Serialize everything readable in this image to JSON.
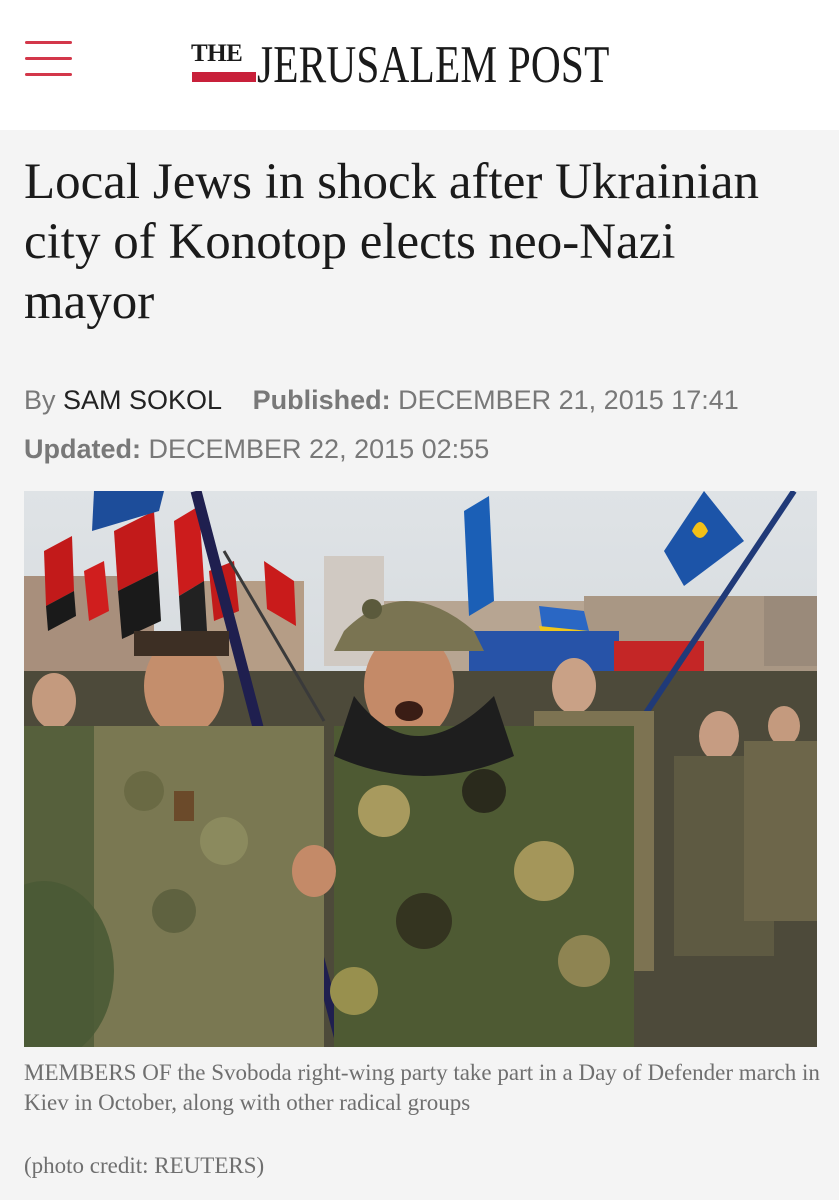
{
  "header": {
    "logo_the": "THE",
    "logo_name": "JERUSALEM POST",
    "accent_color": "#d3374a"
  },
  "article": {
    "headline": "Local Jews in shock after Ukrainian city of Konotop elects neo-Nazi mayor",
    "by_label": "By",
    "author": "SAM SOKOL",
    "published_label": "Published:",
    "published_date": "DECEMBER 21, 2015 17:41",
    "updated_label": "Updated:",
    "updated_date": "DECEMBER 22, 2015 02:55"
  },
  "image": {
    "caption": "MEMBERS OF the Svoboda right-wing party take part in a Day of Defender march in Kiev in October, along with other radical groups",
    "credit": "(photo credit: REUTERS)"
  }
}
